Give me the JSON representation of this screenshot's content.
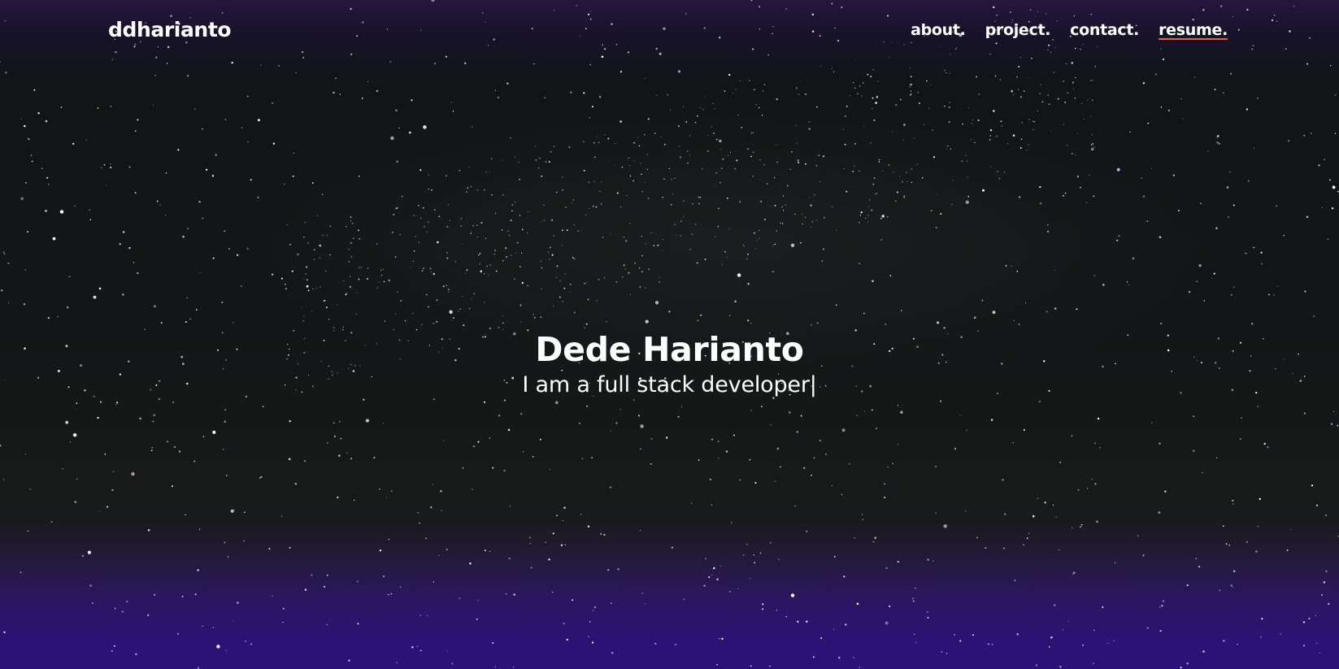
{
  "header": {
    "brand": "ddharianto",
    "nav": [
      {
        "label": "about."
      },
      {
        "label": "project."
      },
      {
        "label": "contact."
      },
      {
        "label": "resume.",
        "active": true
      }
    ]
  },
  "hero": {
    "name": "Dede Harianto",
    "tagline": "I am a full stack developer",
    "cursor": "|"
  },
  "colors": {
    "text": "#ffffff",
    "active_underline": "#e8643c",
    "sky_dark": "#131616",
    "horizon_purple": "#2d1078"
  },
  "background": {
    "icon": "starfield-night-sky"
  }
}
